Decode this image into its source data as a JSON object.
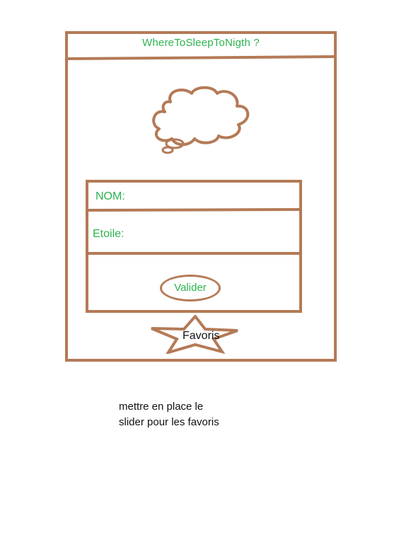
{
  "app": {
    "title": "WhereToSleepToNigth ?"
  },
  "form": {
    "name_label": "NOM:",
    "stars_label": "Etoile:",
    "submit_label": "Valider"
  },
  "favorites": {
    "label": "Favoris"
  },
  "note": {
    "text": "mettre en  place le\nslider pour les favoris"
  },
  "colors": {
    "sketch_brown": "#b47a57",
    "text_green": "#2db34f",
    "text_dark": "#111111"
  },
  "icons": {
    "logo": "thought-cloud-icon",
    "favorites": "star-icon"
  }
}
